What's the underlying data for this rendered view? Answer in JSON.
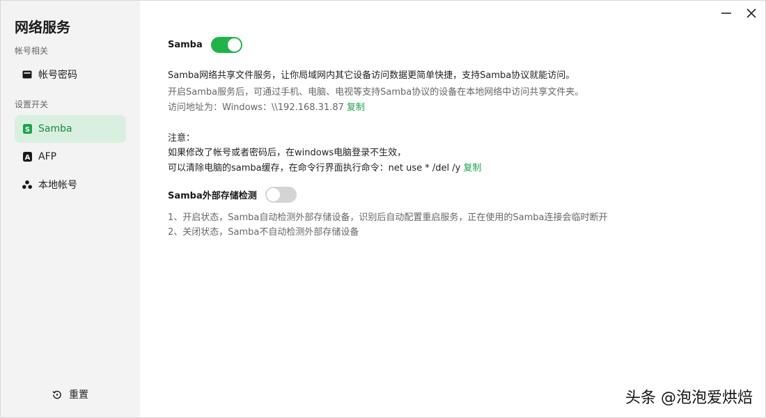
{
  "window": {
    "minimize_icon": "minimize-icon",
    "close_icon": "close-icon"
  },
  "sidebar": {
    "title": "网络服务",
    "sections": [
      {
        "label": "帐号相关"
      },
      {
        "label": "设置开关"
      }
    ],
    "items": [
      {
        "label": "帐号密码",
        "icon": "card-icon"
      },
      {
        "label": "Samba",
        "icon": "samba-s-icon",
        "active": true
      },
      {
        "label": "AFP",
        "icon": "afp-a-icon"
      },
      {
        "label": "本地帐号",
        "icon": "users-icon"
      }
    ],
    "reset_label": "重置"
  },
  "samba": {
    "title": "Samba",
    "enabled": true,
    "desc1": "Samba网络共享文件服务，让你局域网内其它设备访问数据更简单快捷，支持Samba协议就能访问。",
    "desc2": "开启Samba服务后，可通过手机、电脑、电视等支持Samba协议的设备在本地网络中访问共享文件夹。",
    "address_prefix": "访问地址为：Windows：\\\\192.168.31.87",
    "copy_label": "复制",
    "note_title": "注意：",
    "note1": "如果修改了帐号或者密码后，在windows电脑登录不生效，",
    "note2": "可以清除电脑的samba缓存，在命令行界面执行命令：net use * /del /y",
    "copy_label2": "复制"
  },
  "external": {
    "title": "Samba外部存储检测",
    "enabled": false,
    "item1": "1、开启状态，Samba自动检测外部存储设备，识别后自动配置重启服务，正在使用的Samba连接会临时断开",
    "item2": "2、关闭状态，Samba不自动检测外部存储设备"
  },
  "watermark": "头条 @泡泡爱烘焙",
  "colors": {
    "accent": "#1fb34a",
    "active_bg": "#d9efe0",
    "sidebar_bg": "#f3f3f3"
  }
}
